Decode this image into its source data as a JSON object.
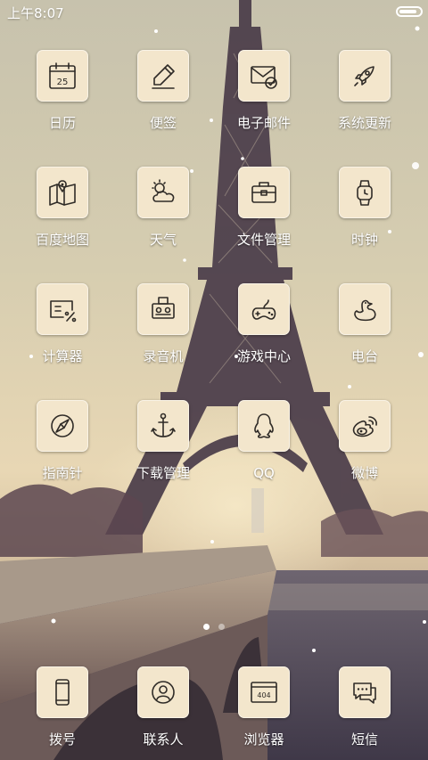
{
  "status_bar": {
    "time": "上午8:07",
    "battery_level": 0.9
  },
  "apps": [
    {
      "id": "calendar",
      "label": "日历",
      "icon": "calendar-icon",
      "calendar_day": "25"
    },
    {
      "id": "notes",
      "label": "便签",
      "icon": "pen-icon"
    },
    {
      "id": "email",
      "label": "电子邮件",
      "icon": "mail-icon"
    },
    {
      "id": "system-update",
      "label": "系统更新",
      "icon": "rocket-icon"
    },
    {
      "id": "baidu-map",
      "label": "百度地图",
      "icon": "map-icon"
    },
    {
      "id": "weather",
      "label": "天气",
      "icon": "weather-icon"
    },
    {
      "id": "file-manager",
      "label": "文件管理",
      "icon": "briefcase-icon"
    },
    {
      "id": "clock",
      "label": "时钟",
      "icon": "watch-icon"
    },
    {
      "id": "calculator",
      "label": "计算器",
      "icon": "calculator-icon"
    },
    {
      "id": "recorder",
      "label": "录音机",
      "icon": "recorder-icon"
    },
    {
      "id": "game-center",
      "label": "游戏中心",
      "icon": "gamepad-icon"
    },
    {
      "id": "radio",
      "label": "电台",
      "icon": "duck-icon"
    },
    {
      "id": "compass",
      "label": "指南针",
      "icon": "compass-icon"
    },
    {
      "id": "download-manager",
      "label": "下载管理",
      "icon": "anchor-icon"
    },
    {
      "id": "qq",
      "label": "QQ",
      "icon": "qq-penguin-icon"
    },
    {
      "id": "weibo",
      "label": "微博",
      "icon": "weibo-icon"
    }
  ],
  "pager": {
    "pages": 2,
    "current": 1
  },
  "dock": [
    {
      "id": "dialer",
      "label": "拨号",
      "icon": "phone-icon"
    },
    {
      "id": "contacts",
      "label": "联系人",
      "icon": "contact-icon"
    },
    {
      "id": "browser",
      "label": "浏览器",
      "icon": "browser-icon",
      "badge_text": "404"
    },
    {
      "id": "messages",
      "label": "短信",
      "icon": "chat-bubble-icon"
    }
  ]
}
